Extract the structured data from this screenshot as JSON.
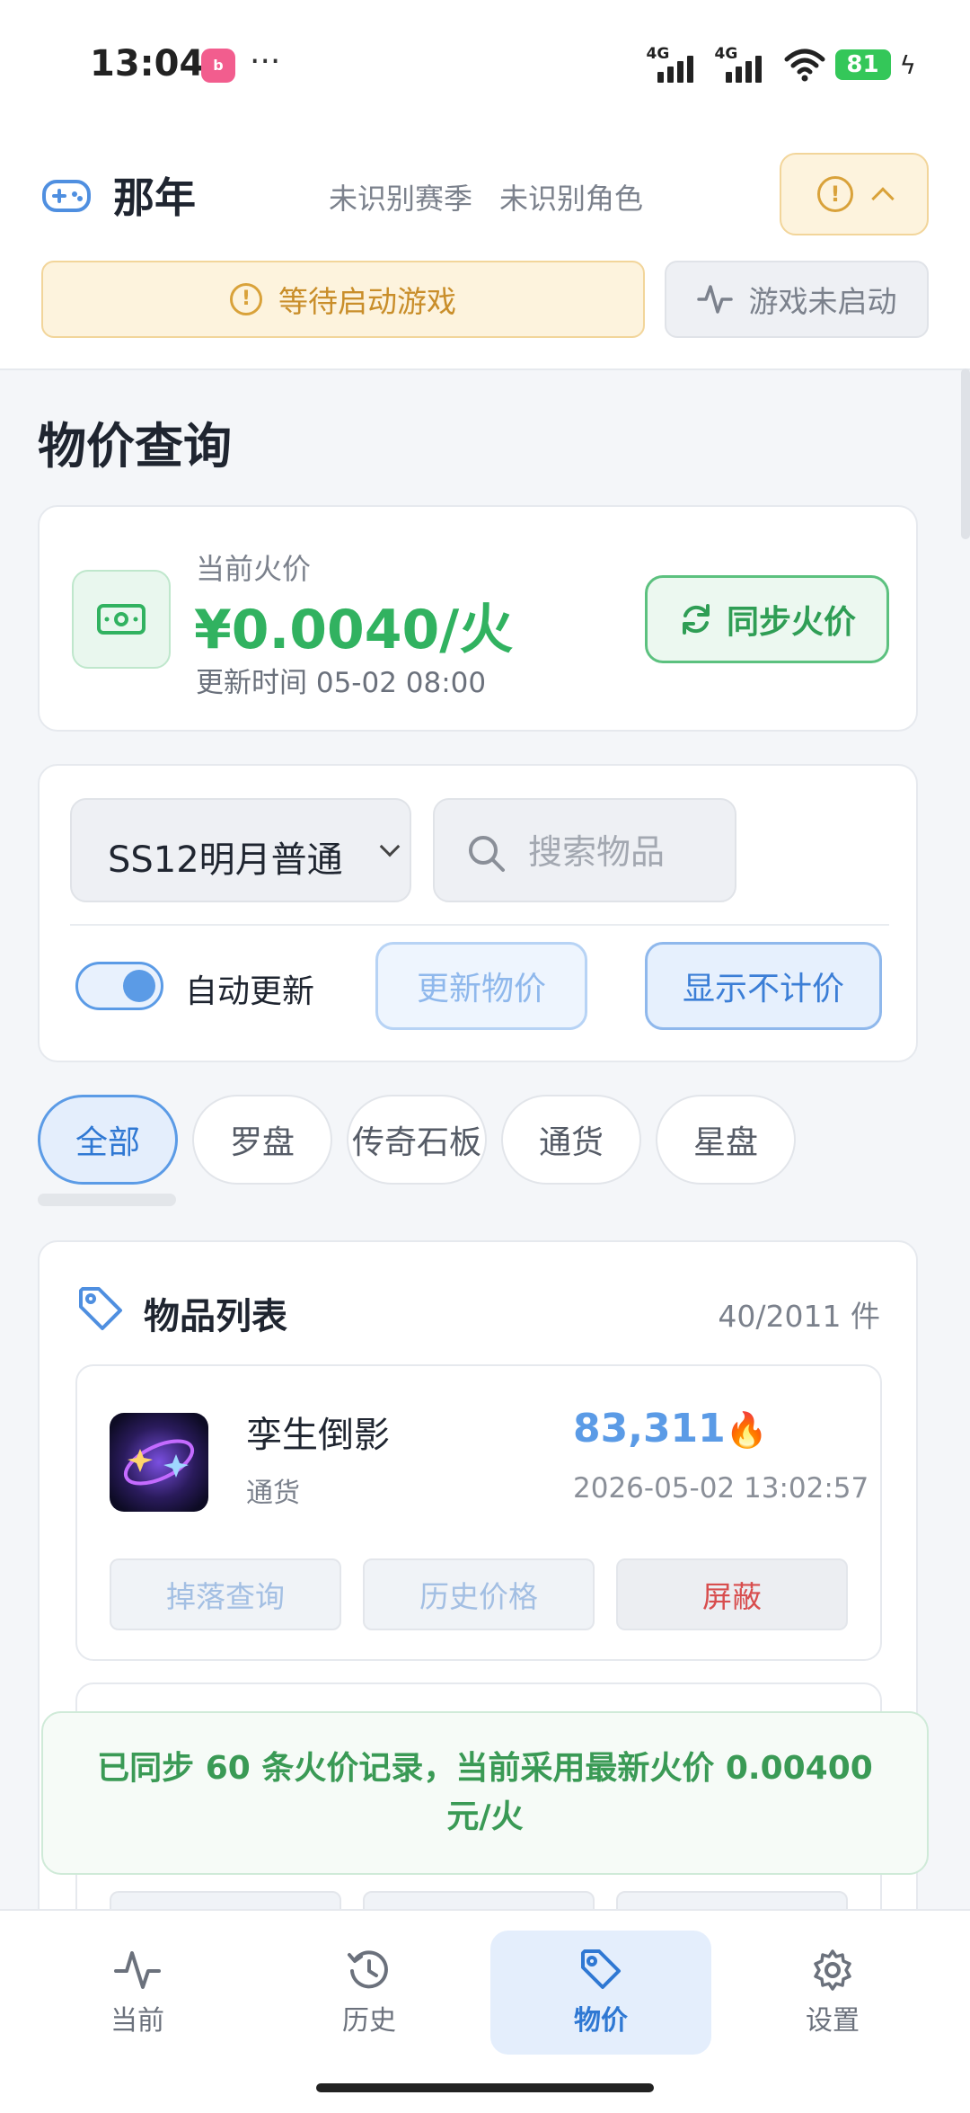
{
  "status_bar": {
    "time": "13:04",
    "app_icon_text": "bilibili",
    "more": "···",
    "net1": "4G",
    "net2": "4G",
    "battery": "81"
  },
  "header": {
    "title": "那年",
    "season_status": "未识别赛季",
    "role_status": "未识别角色",
    "waiting_text": "等待启动游戏",
    "game_status": "游戏未启动"
  },
  "page": {
    "title": "物价查询"
  },
  "price_card": {
    "label": "当前火价",
    "value": "¥0.0040/火",
    "update_time": "更新时间 05-02 08:00",
    "sync_label": "同步火价"
  },
  "filters": {
    "season_value": "SS12明月普通",
    "search_placeholder": "搜索物品",
    "auto_update_label": "自动更新",
    "auto_update_on": true,
    "update_price_label": "更新物价",
    "show_unpriced_label": "显示不计价"
  },
  "categories": [
    {
      "label": "全部",
      "active": true
    },
    {
      "label": "罗盘",
      "active": false
    },
    {
      "label": "传奇石板",
      "active": false
    },
    {
      "label": "通货",
      "active": false
    },
    {
      "label": "星盘",
      "active": false
    }
  ],
  "list": {
    "title": "物品列表",
    "count": "40/2011 件",
    "items": [
      {
        "name": "孪生倒影",
        "type": "通货",
        "price": "83,311",
        "time": "2026-05-02 13:02:57",
        "actions": [
          "掉落查询",
          "历史价格",
          "屏蔽"
        ]
      }
    ]
  },
  "toast": {
    "text": "已同步 60 条火价记录，当前采用最新火价 0.00400 元/火"
  },
  "bottom_nav": [
    {
      "label": "当前",
      "icon": "activity-icon",
      "active": false
    },
    {
      "label": "历史",
      "icon": "history-icon",
      "active": false
    },
    {
      "label": "物价",
      "icon": "tag-icon",
      "active": true
    },
    {
      "label": "设置",
      "icon": "gear-icon",
      "active": false
    }
  ],
  "colors": {
    "accent": "#5b9be6",
    "green": "#31b260",
    "warning": "#d9a23a",
    "danger": "#d84e4e"
  }
}
